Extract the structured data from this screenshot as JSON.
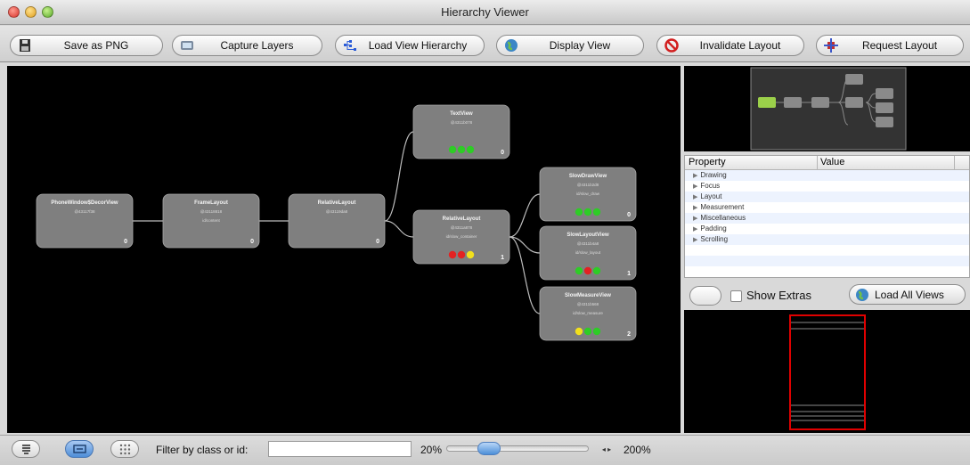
{
  "window": {
    "title": "Hierarchy Viewer"
  },
  "toolbar": {
    "save_png": "Save as PNG",
    "capture_layers": "Capture Layers",
    "load_view_hierarchy": "Load View Hierarchy",
    "display_view": "Display View",
    "invalidate_layout": "Invalidate Layout",
    "request_layout": "Request Layout"
  },
  "tree": {
    "nodes": [
      {
        "title": "PhoneWindow$DecorView",
        "address": "@43117f38",
        "id": "",
        "index": "0"
      },
      {
        "title": "FrameLayout",
        "address": "@43118818",
        "id": "id/content",
        "index": "0"
      },
      {
        "title": "RelativeLayout",
        "address": "@43119da8",
        "id": "",
        "index": "0"
      },
      {
        "title": "TextView",
        "address": "@4311b078",
        "id": "",
        "index": "0"
      },
      {
        "title": "RelativeLayout",
        "address": "@4311a878",
        "id": "id/slow_container",
        "index": "1"
      },
      {
        "title": "SlowDrawView",
        "address": "@4311b2d8",
        "id": "id/slow_draw",
        "index": "0"
      },
      {
        "title": "SlowLayoutView",
        "address": "@4311b4a8",
        "id": "id/slow_layout",
        "index": "1"
      },
      {
        "title": "SlowMeasureView",
        "address": "@4311b568",
        "id": "id/slow_measure",
        "index": "2"
      }
    ],
    "status_colors": {
      "green": "#2ecc26",
      "red": "#e32222",
      "yellow": "#f2e01c"
    }
  },
  "properties": {
    "col_property": "Property",
    "col_value": "Value",
    "groups": [
      "Drawing",
      "Focus",
      "Layout",
      "Measurement",
      "Miscellaneous",
      "Padding",
      "Scrolling"
    ]
  },
  "props_bar": {
    "show_extras": "Show Extras",
    "load_all_views": "Load All Views"
  },
  "bottom": {
    "filter_label": "Filter by class or id:",
    "filter_value": "",
    "zoom_min": "20%",
    "zoom_max": "200%",
    "zoom_level": 0.2
  },
  "colors": {
    "selected_node": "#9bd04a",
    "preview_border": "#e00000"
  }
}
